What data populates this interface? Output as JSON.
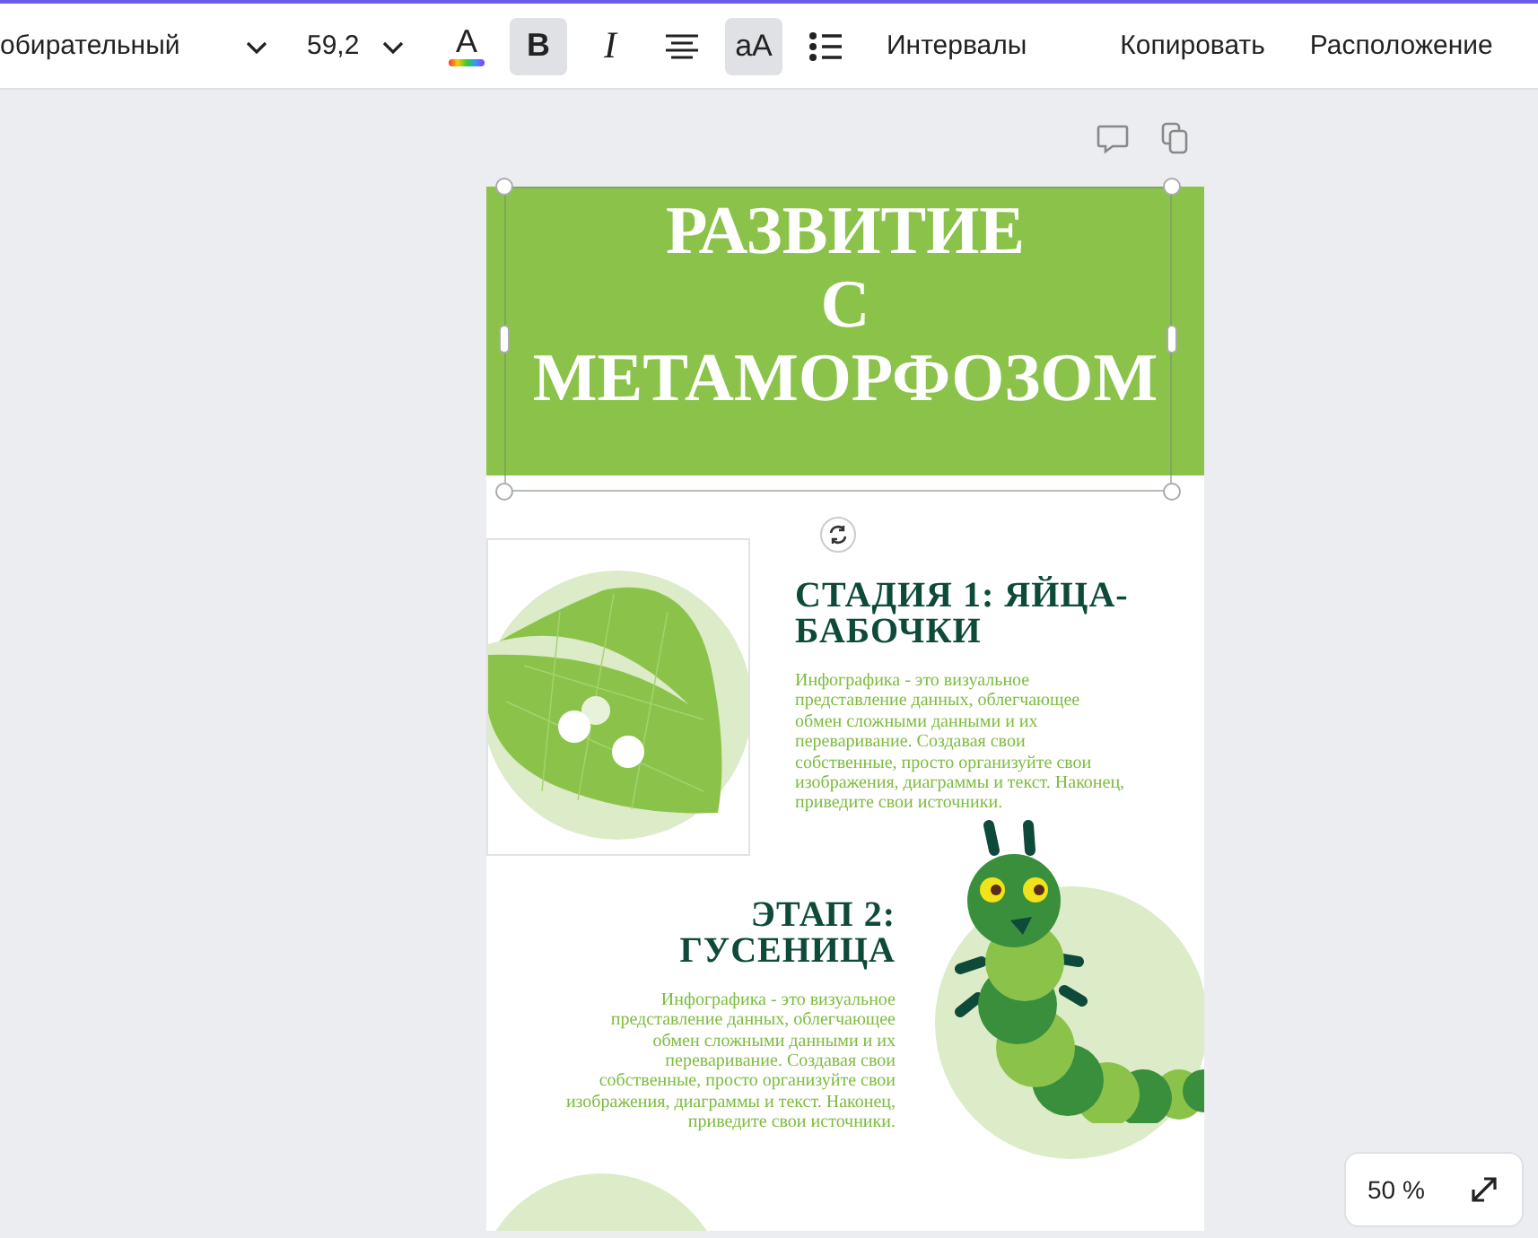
{
  "toolbar": {
    "font_name": "обирательный",
    "font_size": "59,2",
    "format_buttons": [
      {
        "kind": "text-color",
        "label": "A",
        "selected": false
      },
      {
        "kind": "bold",
        "label": "B",
        "selected": true
      },
      {
        "kind": "italic",
        "label": "I",
        "selected": false
      },
      {
        "kind": "align",
        "selected": false
      },
      {
        "kind": "case",
        "label": "aA",
        "selected": true
      },
      {
        "kind": "list",
        "selected": false
      }
    ],
    "spacing_label": "Интервалы",
    "actions": [
      "Копировать",
      "Расположение"
    ]
  },
  "page": {
    "title_lines": [
      "РАЗВИТИЕ",
      "С",
      "МЕТАМОРФОЗОМ"
    ],
    "title_selected": true,
    "sections": [
      {
        "kind": "left",
        "heading": "СТАДИЯ 1: ЯЙЦА-БАБОЧКИ",
        "body": "Инфографика - это визуальное представление данных, облегчающее обмен сложными данными и их переваривание. Создавая свои собственные, просто организуйте свои изображения, диаграммы и текст. Наконец, приведите свои источники."
      },
      {
        "kind": "right",
        "heading": "ЭТАП 2: ГУСЕНИЦА",
        "body": "Инфографика - это визуальное представление данных, облегчающее обмен сложными данными и их переваривание. Создавая свои собственные, просто организуйте свои изображения, диаграммы и текст. Наконец, приведите свои источники."
      }
    ]
  },
  "zoom": {
    "level_label": "50 %"
  }
}
